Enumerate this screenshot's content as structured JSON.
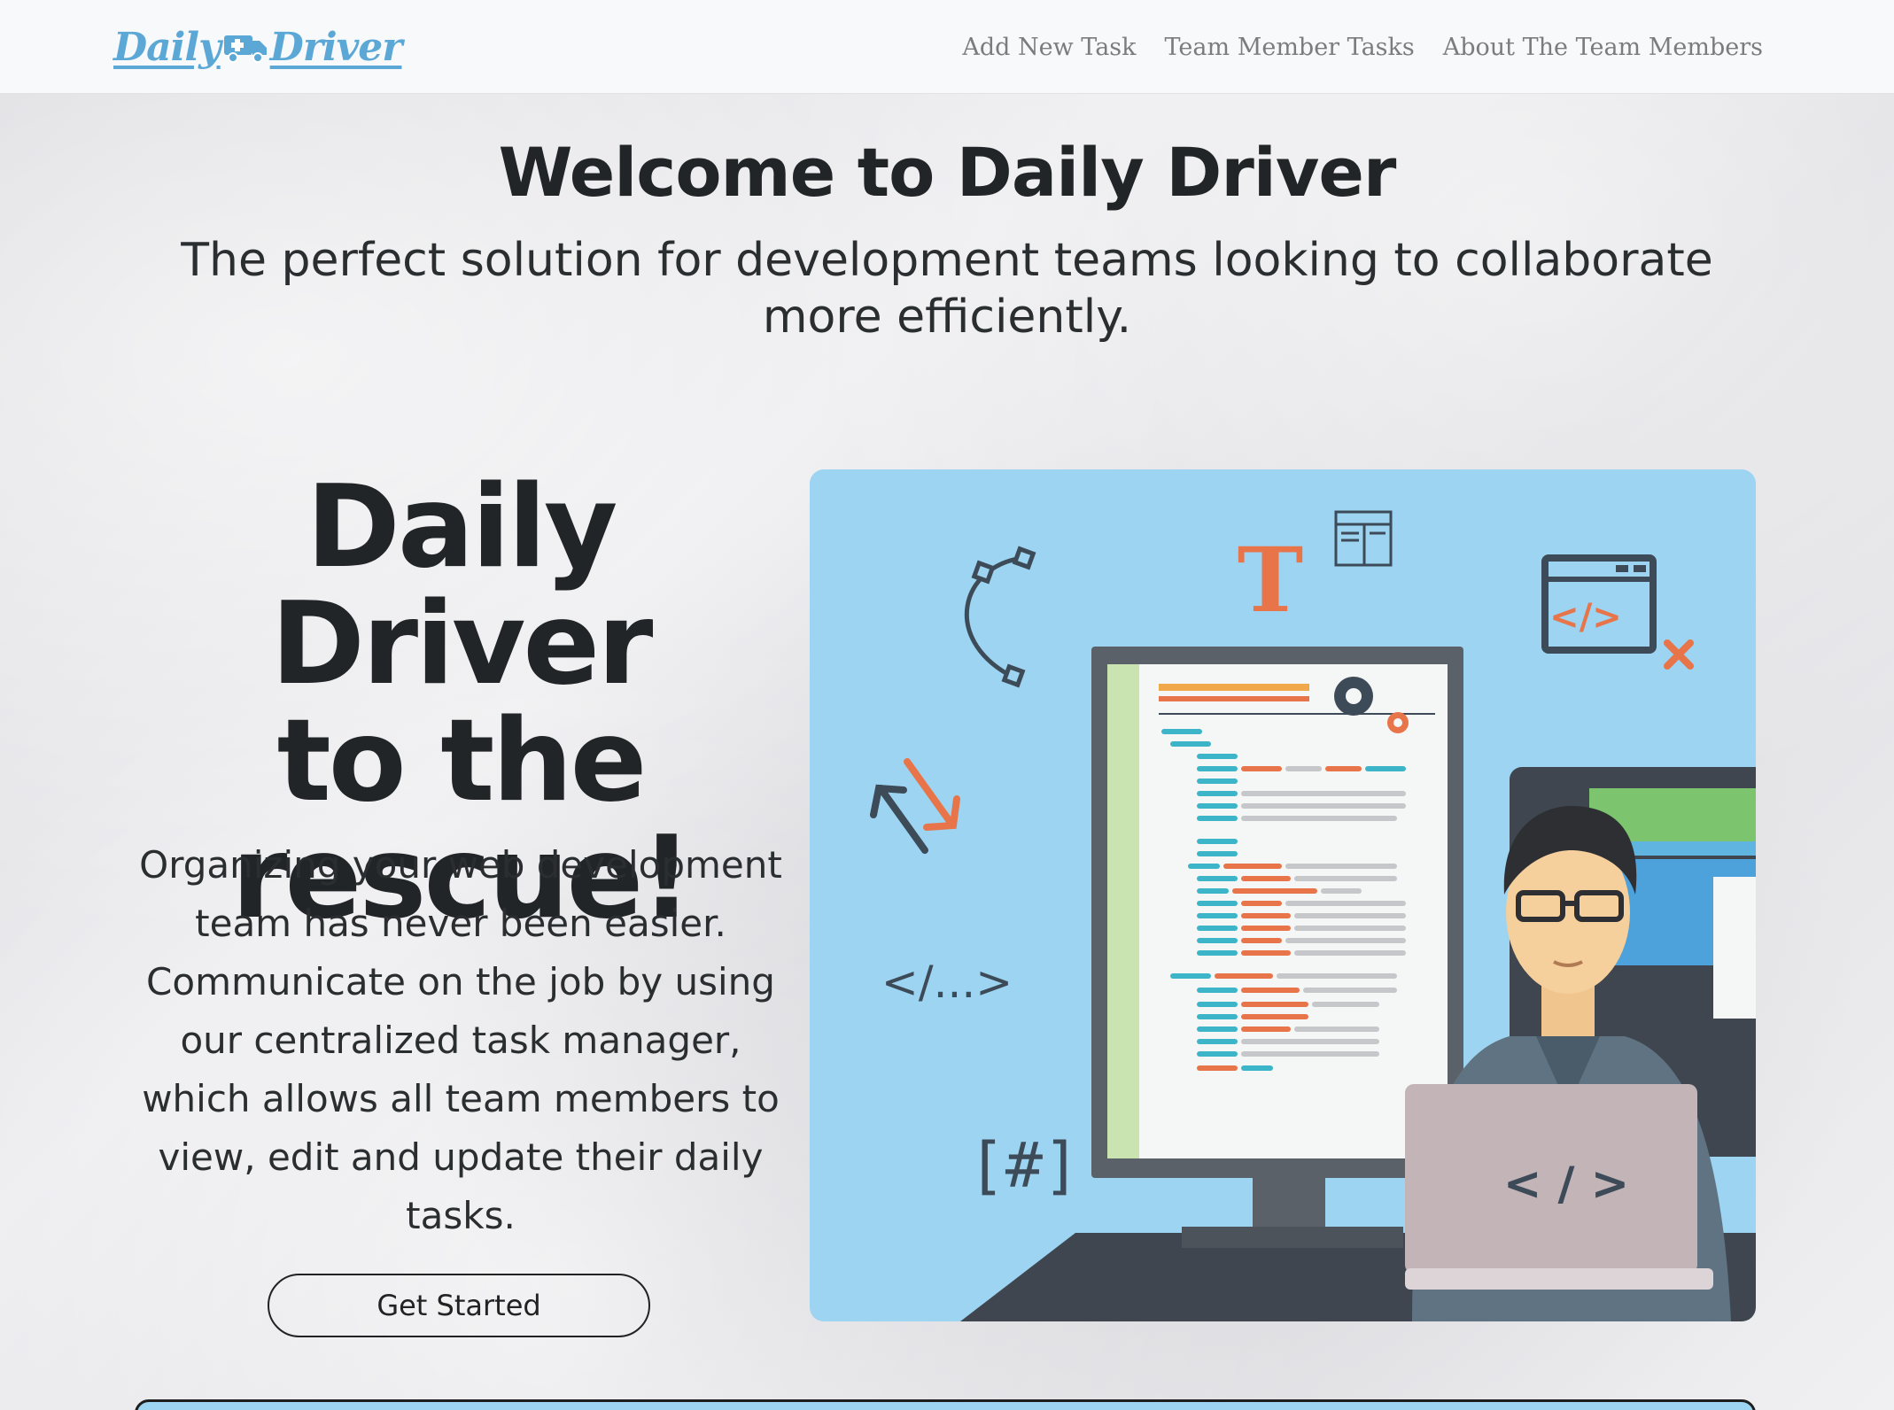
{
  "navbar": {
    "brand": {
      "word1": "Daily",
      "word2": "Driver",
      "icon": "ambulance-icon"
    },
    "links": [
      "Add New Task",
      "Team Member Tasks",
      "About The Team Members"
    ]
  },
  "hero": {
    "title": "Welcome to Daily Driver",
    "subtitle": "The perfect solution for development teams looking to collaborate more efficiently."
  },
  "feature": {
    "headline_line1": "Daily Driver",
    "headline_line2": "to the",
    "headline_line3": "rescue!",
    "body": "Organizing your web development team has never been easier. Communicate on the job by using our centralized task manager, which allows all team members to view, edit and update their daily tasks.",
    "cta_label": "Get Started"
  },
  "illustration": {
    "icon": "developer-at-computer-illustration",
    "glyphs": {
      "code_tag": "</...>",
      "hash": "[#]",
      "laptop_code": "< / >",
      "window_code": "</>",
      "type_letter": "T"
    }
  },
  "colors": {
    "brand_blue": "#5ba8d6",
    "illustration_bg": "#9cd4f1",
    "accent_orange": "#e8744a",
    "code_teal": "#3db5c8"
  }
}
